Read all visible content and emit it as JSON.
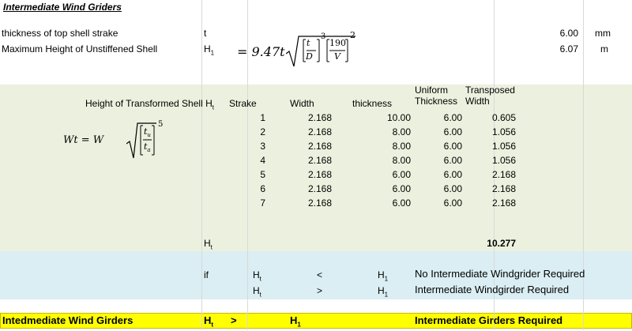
{
  "title": "Intermediate Wind Griders",
  "inputs": {
    "row1": {
      "label": "thickness of top shell strake",
      "symbol": "t",
      "value": "6.00",
      "unit": "mm"
    },
    "row2": {
      "label": "Maximum Height of Unstiffened Shell",
      "symbol": "H",
      "symbol_sub": "1",
      "value": "6.07",
      "unit": "m"
    }
  },
  "formula1": {
    "lhs": "= 9.47t",
    "t": "t",
    "D": "D",
    "exp3": "3",
    "num": "190",
    "V": "V",
    "exp2": "2"
  },
  "table": {
    "header_label": "Height of Transformed Shell H",
    "header_label_sub": "t",
    "col_strake": "Strake",
    "col_width": "Width",
    "col_thickness": "thickness",
    "col_uniform_1": "Uniform",
    "col_uniform_2": "Thickness",
    "col_transposed_1": "Transposed",
    "col_transposed_2": "Width",
    "rows": [
      {
        "strake": "1",
        "width": "2.168",
        "thickness": "10.00",
        "uniform": "6.00",
        "transposed": "0.605"
      },
      {
        "strake": "2",
        "width": "2.168",
        "thickness": "8.00",
        "uniform": "6.00",
        "transposed": "1.056"
      },
      {
        "strake": "3",
        "width": "2.168",
        "thickness": "8.00",
        "uniform": "6.00",
        "transposed": "1.056"
      },
      {
        "strake": "4",
        "width": "2.168",
        "thickness": "8.00",
        "uniform": "6.00",
        "transposed": "1.056"
      },
      {
        "strake": "5",
        "width": "2.168",
        "thickness": "6.00",
        "uniform": "6.00",
        "transposed": "2.168"
      },
      {
        "strake": "6",
        "width": "2.168",
        "thickness": "6.00",
        "uniform": "6.00",
        "transposed": "2.168"
      },
      {
        "strake": "7",
        "width": "2.168",
        "thickness": "6.00",
        "uniform": "6.00",
        "transposed": "2.168"
      }
    ],
    "total_symbol": "H",
    "total_symbol_sub": "t",
    "total_value": "10.277"
  },
  "formula2": {
    "lhs": "Wt = W",
    "tu": "t",
    "tu_sub": "u",
    "ta": "t",
    "ta_sub": "a",
    "exp": "5"
  },
  "comparison": {
    "if_label": "if",
    "row1": {
      "left": "H",
      "left_sub": "t",
      "op": "<",
      "right": "H",
      "right_sub": "1",
      "result": "No Intermediate Windgrider Required"
    },
    "row2": {
      "left": "H",
      "left_sub": "t",
      "op": ">",
      "right": "H",
      "right_sub": "1",
      "result": "Intermediate Windgirder Required"
    }
  },
  "footer": {
    "label": "Intedmediate Wind Girders",
    "left": "H",
    "left_sub": "t",
    "op": ">",
    "right": "H",
    "right_sub": "1",
    "result": "Intermediate Girders Required"
  },
  "colors": {
    "table_bg": "#ebf1de",
    "compare_bg": "#daeef3",
    "footer_bg": "#ffff00",
    "footer_border": "#c9b800"
  }
}
